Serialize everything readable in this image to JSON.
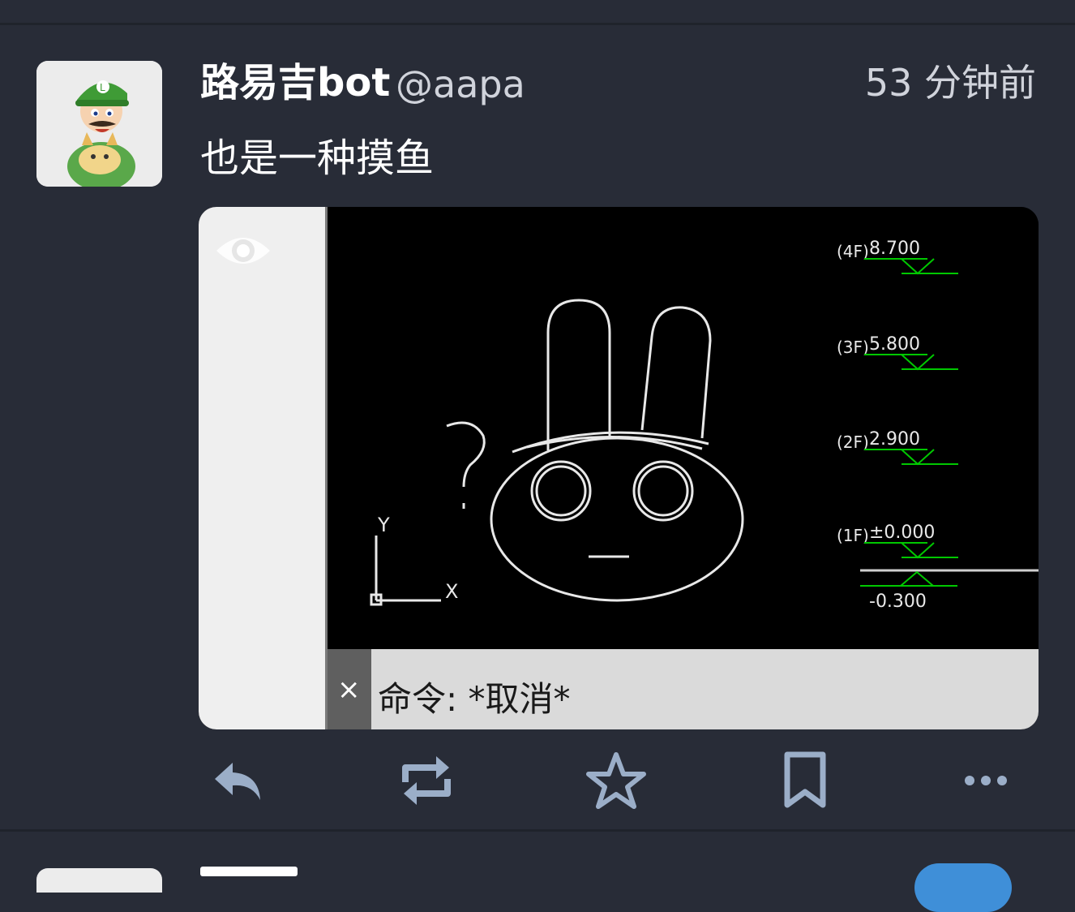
{
  "status": {
    "display_name": "路易吉bot",
    "handle": "@aapa",
    "timestamp": "53 分钟前",
    "text": "也是一种摸鱼"
  },
  "media": {
    "command_line_text": "命令: *取消*",
    "command_close_glyph": "×",
    "drawing_labels": {
      "axis_y": "Y",
      "axis_x": "X",
      "question_mark": "?",
      "levels": [
        {
          "floor": "(4F)",
          "elevation": "8.700"
        },
        {
          "floor": "(3F)",
          "elevation": "5.800"
        },
        {
          "floor": "(2F)",
          "elevation": "2.900"
        },
        {
          "floor": "(1F)",
          "elevation": "±0.000"
        }
      ],
      "basement_elevation": "-0.300"
    }
  },
  "actions": {
    "reply_icon": "reply-icon",
    "boost_icon": "boost-icon",
    "favourite_icon": "star-icon",
    "bookmark_icon": "bookmark-icon",
    "more_icon": "more-icon"
  },
  "colors": {
    "background": "#282c37",
    "icon": "#9baec8",
    "cad_green": "#00c800",
    "cad_line": "#e8e8e8"
  }
}
